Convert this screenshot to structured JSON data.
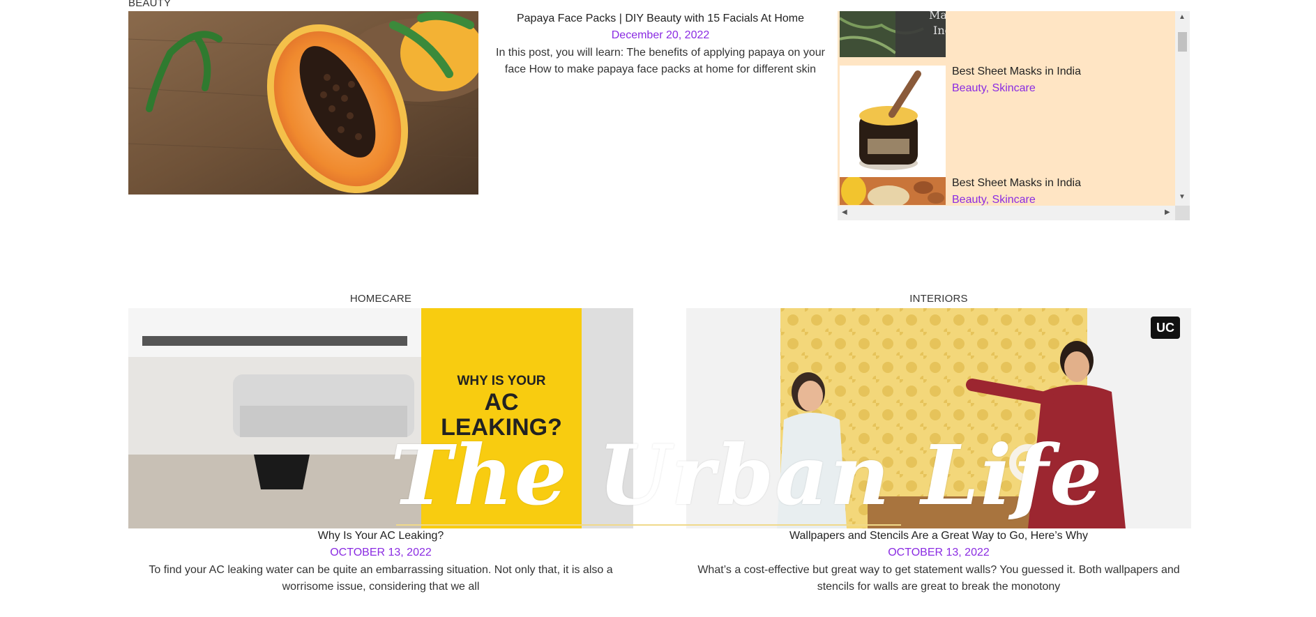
{
  "beauty": {
    "label": "BEAUTY",
    "post": {
      "title": "Papaya Face Packs | DIY Beauty with 15 Facials At Home",
      "date": "December 20, 2022",
      "excerpt_line1": "In this post, you will learn: The benefits of applying papaya on your",
      "excerpt_line2": "face How to make papaya face packs at home for different skin"
    },
    "sidebar": {
      "top_thumb_text_1": "Mask",
      "top_thumb_text_2": "Ind",
      "items": [
        {
          "title": "Best Sheet Masks in India",
          "cat1": "Beauty",
          "sep": ", ",
          "cat2": "Skincare"
        },
        {
          "title": "Best Sheet Masks in India",
          "cat1": "Beauty",
          "sep": ", ",
          "cat2": "Skincare"
        }
      ]
    }
  },
  "homecare": {
    "label": "HOMECARE",
    "image_text": {
      "line1": "WHY IS YOUR",
      "line2": "AC",
      "line3": "LEAKING?"
    },
    "post": {
      "title": "Why Is Your AC Leaking?",
      "date": "OCTOBER 13, 2022",
      "excerpt_line1": "To find your AC leaking water can be quite an embarrassing situation. Not only that, it is also a",
      "excerpt_line2": "worrisome issue, considering that we all"
    }
  },
  "interiors": {
    "label": "INTERIORS",
    "image_badge": "UC",
    "post": {
      "title": "Wallpapers and Stencils Are a Great Way to Go, Here’s Why",
      "date": "OCTOBER 13, 2022",
      "excerpt_line1": "What’s a cost-effective but great way to get statement walls? You guessed it. Both wallpapers and",
      "excerpt_line2": "stencils for walls are great to break the monotony"
    }
  },
  "overlay_logo": "The Urban Life",
  "scroll_icons": {
    "up": "scroll-up-arrow",
    "down": "scroll-down-arrow",
    "left": "scroll-left-arrow",
    "right": "scroll-right-arrow"
  },
  "colors": {
    "accent": "#8a2be2",
    "panel_bg": "#ffe5c4",
    "logo_underline": "#f0d98a"
  }
}
